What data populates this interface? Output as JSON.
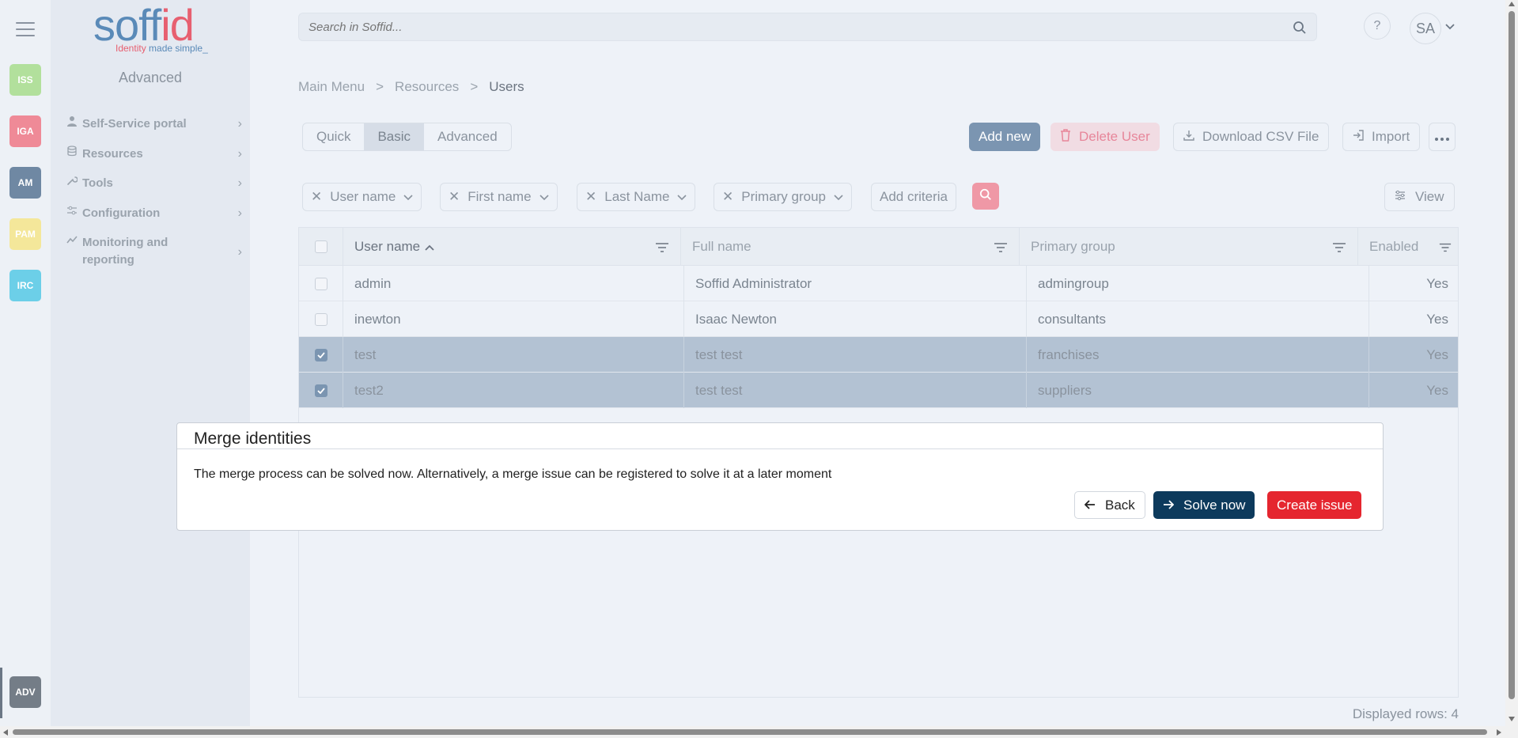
{
  "colors": {
    "iss": "#b2e09c",
    "iga": "#ef8a97",
    "am": "#6f88a3",
    "pam": "#f4e79a",
    "irc": "#6ccfe8",
    "adv": "#747d87",
    "solve": "#0d3a5c",
    "issue": "#e5262f"
  },
  "rail": {
    "items": [
      {
        "label": "ISS",
        "icon": "iss-app"
      },
      {
        "label": "IGA",
        "icon": "iga-app"
      },
      {
        "label": "AM",
        "icon": "am-app"
      },
      {
        "label": "PAM",
        "icon": "pam-app"
      },
      {
        "label": "IRC",
        "icon": "irc-app"
      }
    ],
    "bottom": {
      "label": "ADV"
    }
  },
  "logo": {
    "word_a": "soff",
    "word_b": "id",
    "tag_a": "Identity",
    "tag_b": " made simple_"
  },
  "sidebar": {
    "title": "Advanced",
    "items": [
      {
        "label": "Self-Service portal",
        "icon": "user-icon"
      },
      {
        "label": "Resources",
        "icon": "database-icon"
      },
      {
        "label": "Tools",
        "icon": "wrench-icon"
      },
      {
        "label": "Configuration",
        "icon": "sliders-icon"
      },
      {
        "label": "Monitoring and reporting",
        "icon": "chart-line-icon"
      }
    ]
  },
  "topbar": {
    "search_placeholder": "Search in Soffid...",
    "help": "?",
    "user_initials": "SA"
  },
  "breadcrumb": {
    "items": [
      "Main Menu",
      ">",
      "Resources",
      ">",
      "Users"
    ]
  },
  "modes": [
    "Quick",
    "Basic",
    "Advanced"
  ],
  "toolbar": {
    "add": "Add new",
    "delete": "Delete User",
    "csv": "Download CSV File",
    "import": "Import"
  },
  "filters": {
    "chips": [
      "User name",
      "First name",
      "Last Name",
      "Primary group"
    ],
    "add_criteria": "Add criteria",
    "view": "View"
  },
  "table": {
    "headers": [
      "User name",
      "Full name",
      "Primary group",
      "Enabled"
    ],
    "rows": [
      {
        "user": "admin",
        "full": "Soffid Administrator",
        "group": "admingroup",
        "enabled": "Yes",
        "selected": false
      },
      {
        "user": "inewton",
        "full": "Isaac Newton",
        "group": "consultants",
        "enabled": "Yes",
        "selected": false
      },
      {
        "user": "test",
        "full": "test test",
        "group": "franchises",
        "enabled": "Yes",
        "selected": true
      },
      {
        "user": "test2",
        "full": "test test",
        "group": "suppliers",
        "enabled": "Yes",
        "selected": true
      }
    ],
    "footer": "Displayed rows: 4"
  },
  "modal": {
    "title": "Merge identities",
    "text": "The merge process can be solved now. Alternatively, a merge issue can be registered to solve it at a later moment",
    "back": "Back",
    "solve": "Solve now",
    "issue": "Create issue"
  }
}
